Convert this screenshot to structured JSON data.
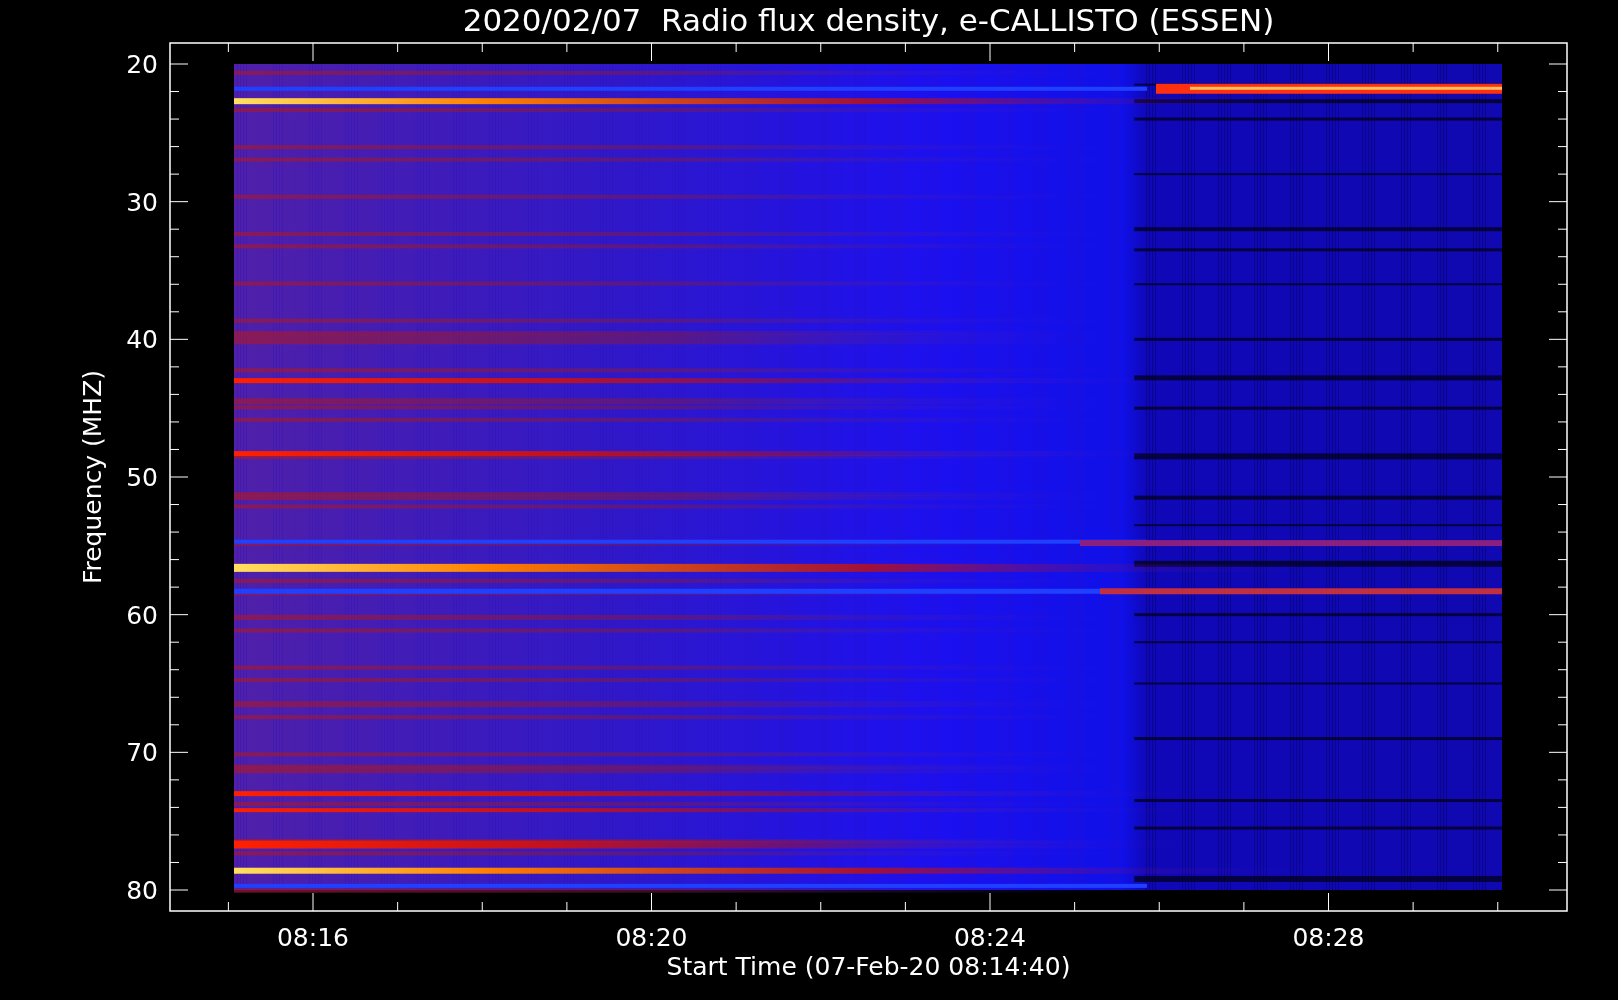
{
  "plot": {
    "title": "2020/02/07  Radio flux density, e-CALLISTO (ESSEN)",
    "xlabel": "Start Time (07-Feb-20 08:14:40)",
    "ylabel": "Frequency (MHZ)",
    "yticks": [
      "20",
      "30",
      "40",
      "50",
      "60",
      "70",
      "80"
    ],
    "xticks": [
      "08:16",
      "08:20",
      "08:24",
      "08:28"
    ]
  }
}
